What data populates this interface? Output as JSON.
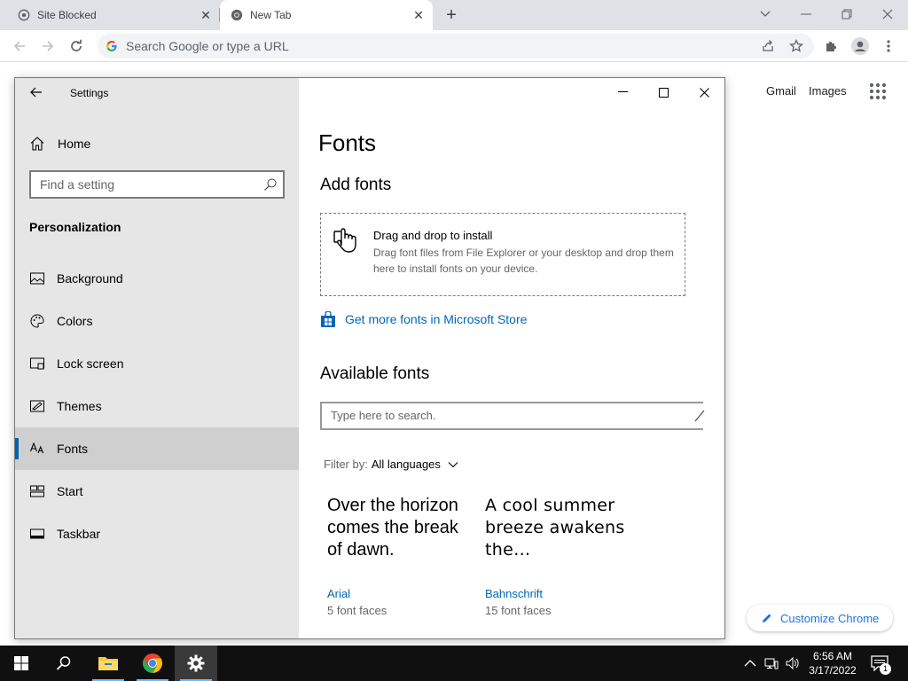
{
  "browser": {
    "tabs": [
      {
        "title": "Site Blocked"
      },
      {
        "title": "New Tab"
      }
    ],
    "address_placeholder": "Search Google or type a URL",
    "ntp": {
      "gmail": "Gmail",
      "images": "Images",
      "customize": "Customize Chrome"
    }
  },
  "settings": {
    "window_title": "Settings",
    "sidebar": {
      "home": "Home",
      "search_placeholder": "Find a setting",
      "section": "Personalization",
      "items": [
        {
          "label": "Background",
          "icon": "image-icon"
        },
        {
          "label": "Colors",
          "icon": "palette-icon"
        },
        {
          "label": "Lock screen",
          "icon": "lock-screen-icon"
        },
        {
          "label": "Themes",
          "icon": "themes-icon"
        },
        {
          "label": "Fonts",
          "icon": "font-icon",
          "active": true
        },
        {
          "label": "Start",
          "icon": "start-icon"
        },
        {
          "label": "Taskbar",
          "icon": "taskbar-icon"
        }
      ]
    },
    "content": {
      "title": "Fonts",
      "add_heading": "Add fonts",
      "drop_title": "Drag and drop to install",
      "drop_desc": "Drag font files from File Explorer or your desktop and drop them here to install fonts on your device.",
      "store_link": "Get more fonts in Microsoft Store",
      "available_heading": "Available fonts",
      "search_placeholder": "Type here to search.",
      "filter_label": "Filter by:",
      "filter_value": "All languages",
      "fonts": [
        {
          "sample": "Over the horizon comes the break of dawn.",
          "name": "Arial",
          "faces": "5 font faces"
        },
        {
          "sample": "A cool summer breeze awakens the…",
          "name": "Bahnschrift",
          "faces": "15 font faces"
        }
      ]
    }
  },
  "taskbar": {
    "time": "6:56 AM",
    "date": "3/17/2022",
    "notification_count": "1"
  },
  "colors": {
    "accent": "#0063b1",
    "link": "#0067b8",
    "chrome_blue": "#1a73e8"
  }
}
